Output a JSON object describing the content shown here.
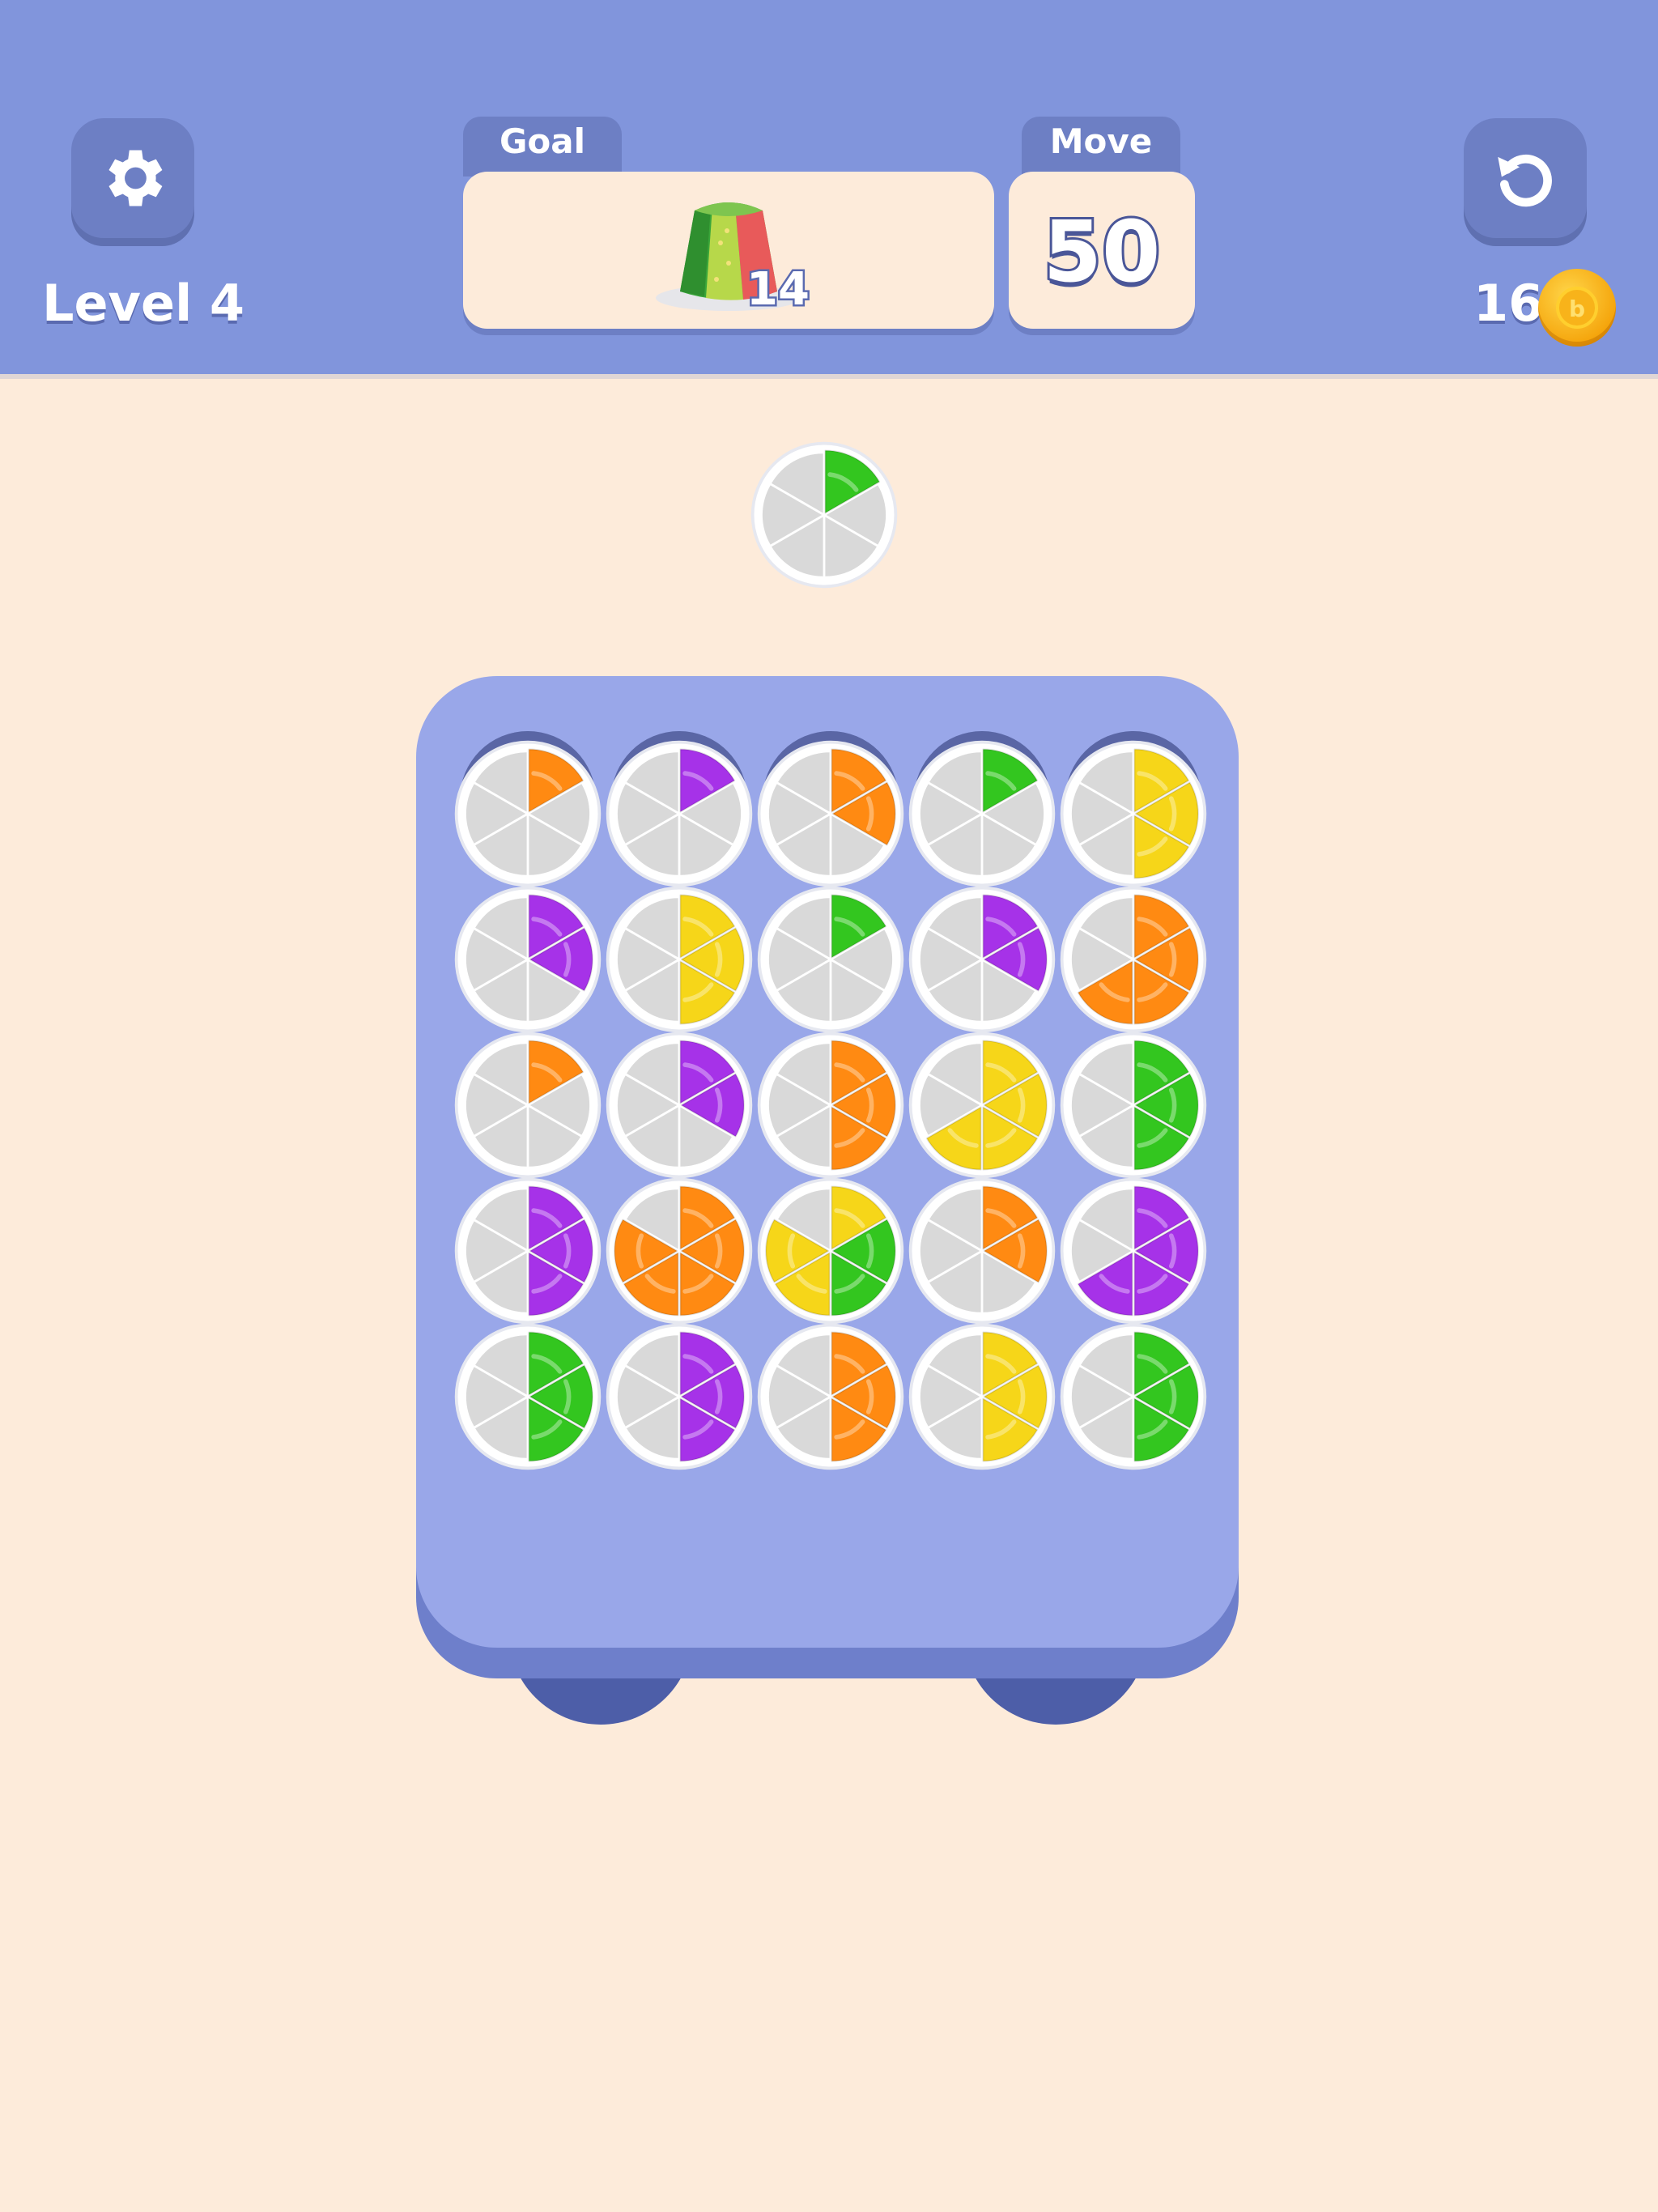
{
  "header": {
    "level_label": "Level 4",
    "goal_tab": "Goal",
    "move_tab": "Move",
    "move_count": "50",
    "goal_count": "14",
    "coin_count": "16",
    "coin_symbol": "b",
    "settings_icon": "gear-icon",
    "restart_icon": "restart-icon",
    "goal_icon": "jelly-cake-icon"
  },
  "colors": {
    "green": "#33c61f",
    "purple": "#a632e8",
    "orange": "#ff8a12",
    "yellow": "#f6d619",
    "empty": "#d9d9d9",
    "topbar": "#8195dc",
    "board": "#99a7e9",
    "background": "#fdebda"
  },
  "next_plate": [
    "green",
    null,
    null,
    null,
    null,
    null
  ],
  "board": {
    "empty_slots": 5,
    "plates": [
      [
        [
          "orange",
          null,
          null,
          null,
          null,
          null
        ],
        [
          "purple",
          null,
          null,
          null,
          null,
          null
        ],
        [
          "orange",
          "orange",
          null,
          null,
          null,
          null
        ],
        [
          "green",
          null,
          null,
          null,
          null,
          null
        ],
        [
          "yellow",
          "yellow",
          "yellow",
          null,
          null,
          null
        ]
      ],
      [
        [
          "purple",
          "purple",
          null,
          null,
          null,
          null
        ],
        [
          "yellow",
          "yellow",
          "yellow",
          null,
          null,
          null
        ],
        [
          "green",
          null,
          null,
          null,
          null,
          null
        ],
        [
          "purple",
          "purple",
          null,
          null,
          null,
          null
        ],
        [
          "orange",
          "orange",
          "orange",
          "orange",
          null,
          null
        ]
      ],
      [
        [
          "orange",
          null,
          null,
          null,
          null,
          null
        ],
        [
          "purple",
          "purple",
          null,
          null,
          null,
          null
        ],
        [
          "orange",
          "orange",
          "orange",
          null,
          null,
          null
        ],
        [
          "yellow",
          "yellow",
          "yellow",
          "yellow",
          null,
          null
        ],
        [
          "green",
          "green",
          "green",
          null,
          null,
          null
        ]
      ],
      [
        [
          "purple",
          "purple",
          "purple",
          null,
          null,
          null
        ],
        [
          "orange",
          "orange",
          "orange",
          "orange",
          "orange",
          null
        ],
        [
          "yellow",
          "green",
          "green",
          "yellow",
          "yellow",
          null
        ],
        [
          "orange",
          "orange",
          null,
          null,
          null,
          null
        ],
        [
          "purple",
          "purple",
          "purple",
          "purple",
          null,
          null
        ]
      ],
      [
        [
          "green",
          "green",
          "green",
          null,
          null,
          null
        ],
        [
          "purple",
          "purple",
          "purple",
          null,
          null,
          null
        ],
        [
          "orange",
          "orange",
          "orange",
          null,
          null,
          null
        ],
        [
          "yellow",
          "yellow",
          "yellow",
          null,
          null,
          null
        ],
        [
          "green",
          "green",
          "green",
          null,
          null,
          null
        ]
      ]
    ]
  }
}
